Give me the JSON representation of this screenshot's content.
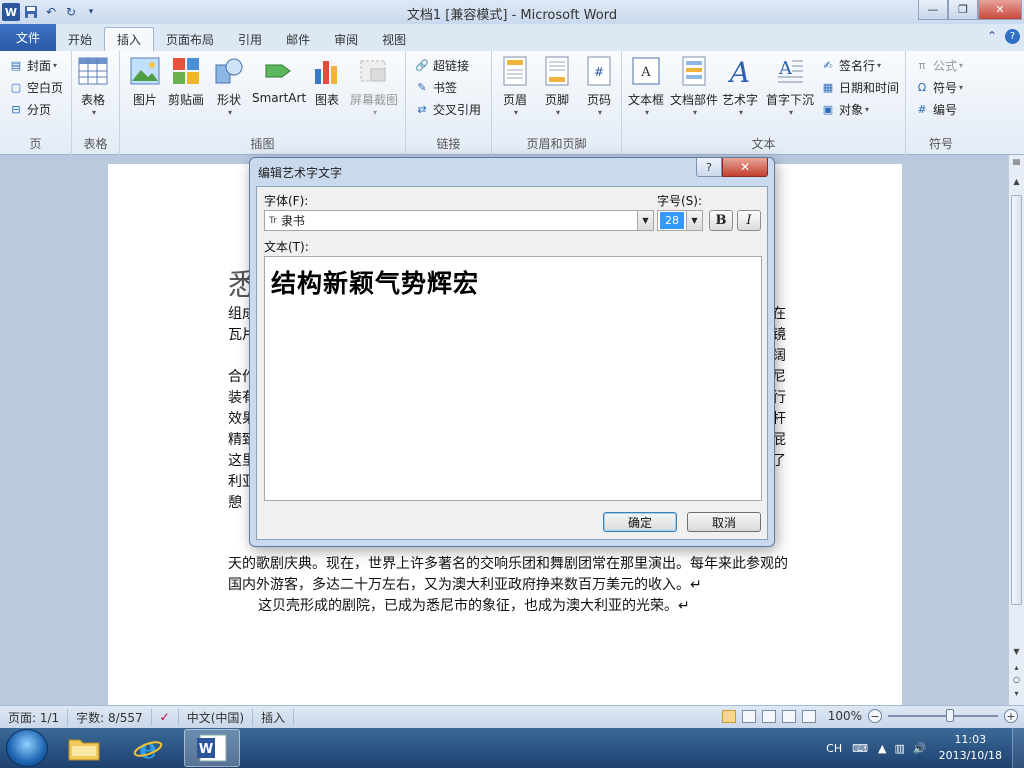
{
  "window": {
    "title": "文档1 [兼容模式] - Microsoft Word",
    "qat_logo": "W",
    "qat_icons": [
      "save-icon",
      "undo-icon",
      "redo-icon",
      "customize-qat-icon"
    ],
    "controls": {
      "minimize": "—",
      "maximize": "❐",
      "close": "✕"
    }
  },
  "tabs": {
    "file": "文件",
    "items": [
      "开始",
      "插入",
      "页面布局",
      "引用",
      "邮件",
      "审阅",
      "视图"
    ],
    "active": "插入"
  },
  "ribbon": {
    "pages": {
      "label": "页",
      "cover": "封面",
      "blank": "空白页",
      "break": "分页"
    },
    "tables": {
      "label": "表格",
      "table": "表格"
    },
    "illustrations": {
      "label": "插图",
      "picture": "图片",
      "clipart": "剪贴画",
      "shapes": "形状",
      "smartart": "SmartArt",
      "chart": "图表",
      "screenshot": "屏幕截图"
    },
    "links": {
      "label": "链接",
      "hyperlink": "超链接",
      "bookmark": "书签",
      "crossref": "交叉引用"
    },
    "header_footer": {
      "label": "页眉和页脚",
      "header": "页眉",
      "footer": "页脚",
      "pagenum": "页码"
    },
    "text": {
      "label": "文本",
      "textbox": "文本框",
      "quickparts": "文档部件",
      "wordart": "艺术字",
      "dropcap": "首字下沉",
      "sigline": "签名行",
      "datetime": "日期和时间",
      "object": "对象"
    },
    "symbols": {
      "label": "符号",
      "equation": "公式",
      "symbol": "符号",
      "number": "编号"
    }
  },
  "document": {
    "left_fragments": [
      "组成",
      "瓦片",
      "合作",
      "装有",
      "效果",
      "精致",
      "这里",
      "利亚",
      "憩"
    ],
    "right_fragments": [
      "在",
      "镜",
      "阔",
      "尼",
      "行",
      "杆",
      "屁",
      "了"
    ],
    "line1": "天的歌剧庆典。现在，世界上许多著名的交响乐团和舞剧团常在那里演出。每年来此参观的",
    "line2": "国内外游客，多达二十万左右，又为澳大利亚政府挣来数百万美元的收入。↵",
    "line3": "这贝壳形成的剧院，已成为悉尼市的象征，也成为澳大利亚的光荣。↵",
    "partial_big_char": "悉"
  },
  "statusbar": {
    "page": "页面: 1/1",
    "words": "字数: 8/557",
    "language": "中文(中国)",
    "mode": "插入",
    "zoom": "100%",
    "zoom_minus": "−",
    "zoom_plus": "+"
  },
  "taskbar": {
    "lang": "CH",
    "time": "11:03",
    "date": "2013/10/18"
  },
  "dialog": {
    "title": "编辑艺术字文字",
    "help": "?",
    "close": "✕",
    "font_label": "字体(F):",
    "font_value": "隶书",
    "font_icon": "Tr",
    "size_label": "字号(S):",
    "size_value": "28",
    "bold": "B",
    "italic": "I",
    "text_label": "文本(T):",
    "text_value": "结构新颖气势辉宏",
    "ok": "确定",
    "cancel": "取消"
  }
}
